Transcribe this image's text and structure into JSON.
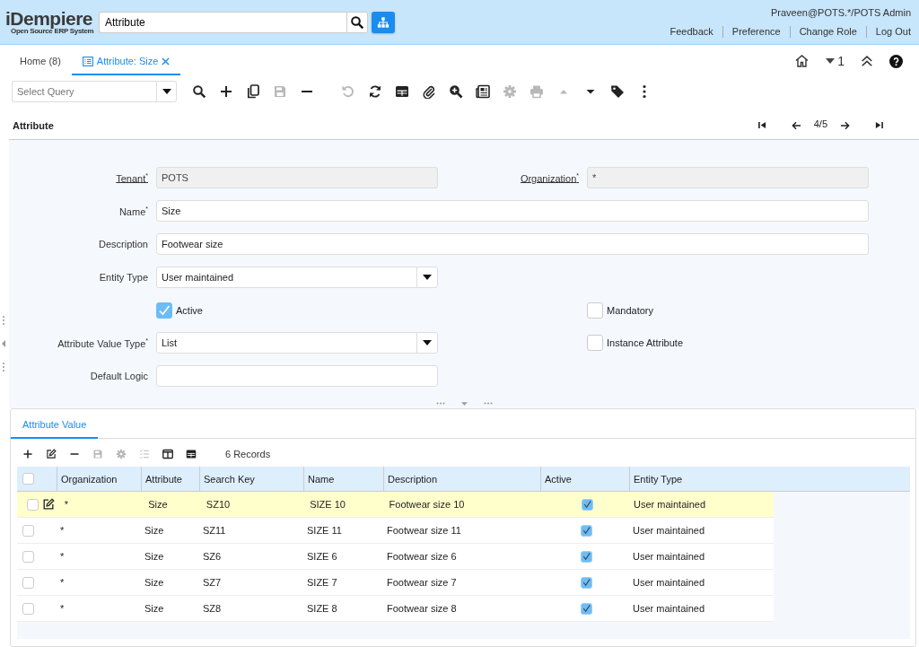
{
  "app": {
    "logo": "iDempiere",
    "tagline": "Open Source ERP System"
  },
  "header": {
    "search": {
      "value": "Attribute"
    },
    "user": "Praveen@POTS.*/POTS Admin",
    "links": [
      "Feedback",
      "Preference",
      "Change Role",
      "Log Out"
    ]
  },
  "tabs": [
    {
      "label": "Home (8)",
      "selected": false,
      "closable": false
    },
    {
      "label": "Attribute: Size",
      "selected": true,
      "closable": true
    }
  ],
  "window_tools": {
    "count": "1"
  },
  "query": {
    "placeholder": "Select Query"
  },
  "toolbar": [
    [
      {
        "kind": "search",
        "disabled": false
      },
      {
        "kind": "add",
        "disabled": false
      },
      {
        "kind": "copy",
        "disabled": false
      },
      {
        "kind": "save",
        "disabled": true
      },
      {
        "kind": "delete",
        "disabled": false
      }
    ],
    [
      {
        "kind": "undo",
        "disabled": true
      },
      {
        "kind": "refresh",
        "disabled": false
      },
      {
        "kind": "grid",
        "disabled": false
      },
      {
        "kind": "attach",
        "disabled": false
      },
      {
        "kind": "zoom",
        "disabled": false
      },
      {
        "kind": "report",
        "disabled": false
      },
      {
        "kind": "gear",
        "disabled": true
      },
      {
        "kind": "print",
        "disabled": true
      },
      {
        "kind": "up",
        "disabled": true
      },
      {
        "kind": "down",
        "disabled": false
      },
      {
        "kind": "tag",
        "disabled": false
      },
      {
        "kind": "more",
        "disabled": false
      }
    ]
  ],
  "record": {
    "title": "Attribute",
    "position": "4/5"
  },
  "form": {
    "rows": [
      {
        "left": {
          "kind": "readonly",
          "label": "Tenant$^{*}$",
          "link": true,
          "value": "POTS"
        },
        "right": {
          "kind": "readonly",
          "label": "Organization$^{*}$",
          "link": true,
          "value": "*"
        }
      },
      {
        "left": {
          "kind": "text-wide",
          "label": "Name$^{*}$",
          "link": false,
          "value": "Size"
        }
      },
      {
        "left": {
          "kind": "text-wide",
          "label": "Description",
          "link": false,
          "value": "Footwear size"
        }
      },
      {
        "left": {
          "kind": "select",
          "label": "Entity Type",
          "link": false,
          "value": "User maintained"
        }
      },
      {
        "left": {
          "kind": "checkbox",
          "label": "Active",
          "checked": true
        },
        "right": {
          "kind": "checkbox",
          "label": "Mandatory",
          "checked": false
        }
      },
      {
        "left": {
          "kind": "select",
          "label": "Attribute Value Type$^{*}$",
          "link": false,
          "value": "List"
        },
        "right": {
          "kind": "checkbox",
          "label": "Instance Attribute",
          "checked": false
        }
      },
      {
        "left": {
          "kind": "text",
          "label": "Default Logic",
          "link": false
        }
      }
    ]
  },
  "detail": {
    "tabs": [
      {
        "label": "Attribute Value",
        "selected": true
      }
    ],
    "toolbar": [
      {
        "kind": "add",
        "disabled": false
      },
      {
        "kind": "edit",
        "disabled": false
      },
      {
        "kind": "delete",
        "disabled": false
      },
      {
        "kind": "save",
        "disabled": true
      },
      {
        "kind": "gear",
        "disabled": true
      },
      {
        "kind": "checklist",
        "disabled": true
      },
      {
        "kind": "columns",
        "disabled": false
      },
      {
        "kind": "grid",
        "disabled": false
      }
    ],
    "record_count": "6 Records",
    "all_selected": false,
    "columns": [
      "Organization",
      "Attribute",
      "Search Key",
      "Name",
      "Description",
      "Active",
      "Entity Type"
    ],
    "rows": [
      {
        "selected": true,
        "organization": "*",
        "attribute": "Size",
        "search_key": "SZ10",
        "name": "SIZE 10",
        "description": "Footwear size 10",
        "active": true,
        "entity_type": "User maintained"
      },
      {
        "selected": false,
        "organization": "*",
        "attribute": "Size",
        "search_key": "SZ11",
        "name": "SIZE 11",
        "description": "Footwear size 11",
        "active": true,
        "entity_type": "User maintained"
      },
      {
        "selected": false,
        "organization": "*",
        "attribute": "Size",
        "search_key": "SZ6",
        "name": "SIZE 6",
        "description": "Footwear size 6",
        "active": true,
        "entity_type": "User maintained"
      },
      {
        "selected": false,
        "organization": "*",
        "attribute": "Size",
        "search_key": "SZ7",
        "name": "SIZE 7",
        "description": "Footwear size 7",
        "active": true,
        "entity_type": "User maintained"
      },
      {
        "selected": false,
        "organization": "*",
        "attribute": "Size",
        "search_key": "SZ8",
        "name": "SIZE 8",
        "description": "Footwear size 8",
        "active": true,
        "entity_type": "User maintained"
      }
    ]
  }
}
